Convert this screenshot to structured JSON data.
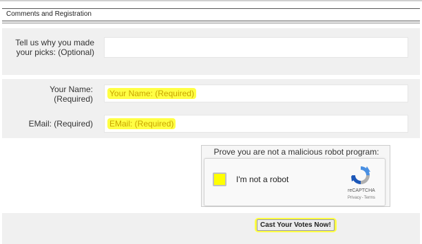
{
  "section": {
    "title": "Comments and Registration"
  },
  "comments": {
    "label": "Tell us why you made your picks: (Optional)",
    "value": ""
  },
  "name": {
    "label": "Your Name: (Required)",
    "placeholder": "Your Name: (Required)"
  },
  "email": {
    "label": "EMail: (Required)",
    "placeholder": "EMail: (Required)"
  },
  "captcha": {
    "prompt": "Prove you are not a malicious robot program:",
    "checkbox_label": "I'm not a robot",
    "brand": "reCAPTCHA",
    "privacy": "Privacy",
    "separator": "-",
    "terms": "Terms",
    "logo_icon": "recaptcha-logo-icon"
  },
  "submit": {
    "label": "Cast Your Votes Now!"
  },
  "colors": {
    "highlight": "#ffff44",
    "panel": "#f0f0f0",
    "placeholder_text": "#c9a400"
  }
}
